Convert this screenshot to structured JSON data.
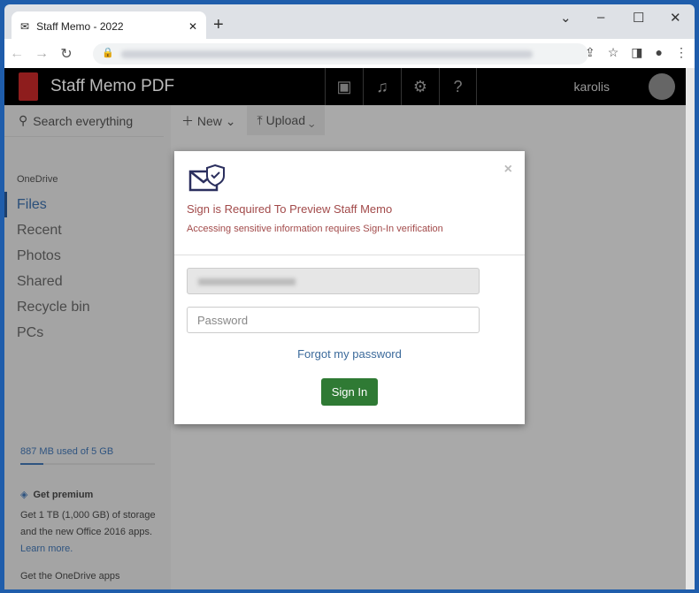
{
  "browser": {
    "tab_title": "Staff Memo - 2022",
    "new_tab": "+",
    "close_tab": "✕",
    "controls": [
      "⌄",
      "–",
      "☐",
      "✕"
    ]
  },
  "app": {
    "title": "Staff Memo PDF",
    "username": "karolis",
    "header_icons": [
      "feedback-icon",
      "bell-icon",
      "gear-icon",
      "help-icon"
    ],
    "help_glyph": "?"
  },
  "sidebar": {
    "search_placeholder": "Search everything",
    "section": "OneDrive",
    "items": [
      {
        "label": "Files",
        "active": true
      },
      {
        "label": "Recent"
      },
      {
        "label": "Photos"
      },
      {
        "label": "Shared"
      },
      {
        "label": "Recycle bin"
      },
      {
        "label": "PCs"
      }
    ],
    "storage": "887 MB used of 5 GB",
    "storage_used_fraction": 0.17,
    "premium_title": "Get premium",
    "premium_text": "Get 1 TB (1,000 GB) of storage and the new Office 2016 apps.",
    "learn_more": "Learn more.",
    "get_apps": "Get the OneDrive apps"
  },
  "commands": {
    "new": "New",
    "upload": "Upload"
  },
  "modal": {
    "title": "Sign is Required To Preview Staff Memo",
    "subtitle": "Accessing sensitive information requires Sign-In verification",
    "password_placeholder": "Password",
    "forgot": "Forgot my password",
    "signin": "Sign In",
    "close": "×",
    "accent": "#2f7a34",
    "title_color": "#a24a4a"
  }
}
